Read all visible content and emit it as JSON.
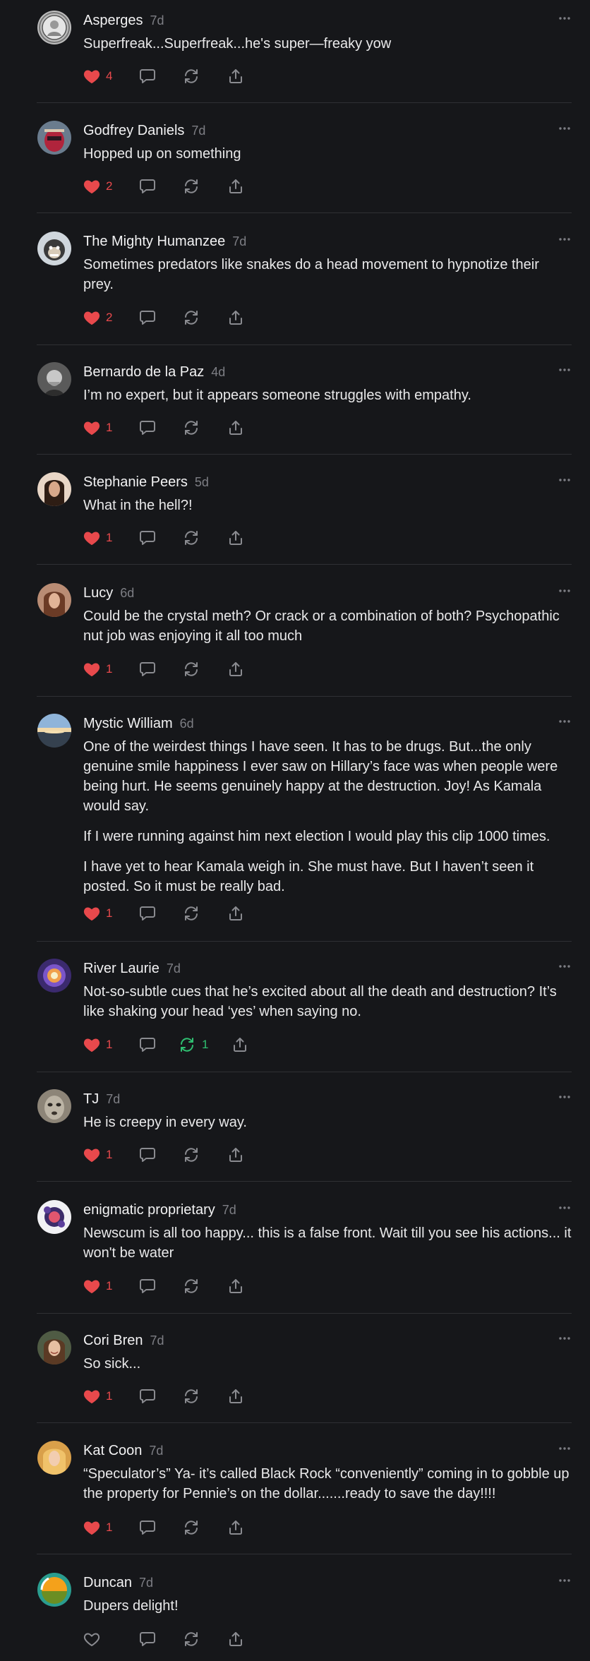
{
  "colors": {
    "background": "#16171a",
    "divider": "#2f3034",
    "like_active": "#e8494c",
    "restack_active": "#2fbf71",
    "icon_default": "#8a8b90"
  },
  "icons": {
    "like": "heart-icon",
    "reply": "comment-icon",
    "restack": "restack-icon",
    "share": "share-icon",
    "more": "more-dots-icon"
  },
  "comments": [
    {
      "name": "Asperges",
      "time": "7d",
      "text": [
        "Superfreak...Superfreak...he's super—freaky yow"
      ],
      "likes": "4",
      "liked": true,
      "restacks": "",
      "restacked": false,
      "avatar": "statue"
    },
    {
      "name": "Godfrey Daniels",
      "time": "7d",
      "text": [
        "Hopped up on something"
      ],
      "likes": "2",
      "liked": true,
      "restacks": "",
      "restacked": false,
      "avatar": "mask"
    },
    {
      "name": "The Mighty Humanzee",
      "time": "7d",
      "text": [
        "Sometimes predators like snakes do a head movement to hypnotize their prey."
      ],
      "likes": "2",
      "liked": true,
      "restacks": "",
      "restacked": false,
      "avatar": "chimp"
    },
    {
      "name": "Bernardo de la Paz",
      "time": "4d",
      "text": [
        "I’m no expert, but it appears someone struggles with empathy."
      ],
      "likes": "1",
      "liked": true,
      "restacks": "",
      "restacked": false,
      "avatar": "bw-man"
    },
    {
      "name": "Stephanie Peers",
      "time": "5d",
      "text": [
        "What in the hell?!"
      ],
      "likes": "1",
      "liked": true,
      "restacks": "",
      "restacked": false,
      "avatar": "woman-dark-hair"
    },
    {
      "name": "Lucy",
      "time": "6d",
      "text": [
        "Could be the crystal meth? Or crack or a combination of both? Psychopathic nut job was enjoying it all too much"
      ],
      "likes": "1",
      "liked": true,
      "restacks": "",
      "restacked": false,
      "avatar": "woman-brown-hair"
    },
    {
      "name": "Mystic William",
      "time": "6d",
      "text": [
        "One of the weirdest things I have seen. It has to be drugs. But...the only genuine smile happiness I ever saw on Hillary’s face was when people were being hurt. He seems genuinely happy at the destruction. Joy! As Kamala would say.",
        "If I were running against him next election I would play this clip 1000 times.",
        "I have yet to hear Kamala weigh in. She must have. But I haven’t seen it posted. So it must be really bad."
      ],
      "likes": "1",
      "liked": true,
      "restacks": "",
      "restacked": false,
      "avatar": "sunset"
    },
    {
      "name": "River Laurie",
      "time": "7d",
      "text": [
        "Not-so-subtle cues that he’s excited about all the death and destruction? It’s like shaking your head ‘yes’ when saying no."
      ],
      "likes": "1",
      "liked": true,
      "restacks": "1",
      "restacked": true,
      "avatar": "mandala"
    },
    {
      "name": "TJ",
      "time": "7d",
      "text": [
        "He is creepy in every way."
      ],
      "likes": "1",
      "liked": true,
      "restacks": "",
      "restacked": false,
      "avatar": "alien"
    },
    {
      "name": "enigmatic proprietary",
      "time": "7d",
      "text": [
        "Newscum is all too happy... this is a false front. Wait till you see his actions... it won't be water"
      ],
      "likes": "1",
      "liked": true,
      "restacks": "",
      "restacked": false,
      "avatar": "pattern"
    },
    {
      "name": "Cori Bren",
      "time": "7d",
      "text": [
        "So sick..."
      ],
      "likes": "1",
      "liked": true,
      "restacks": "",
      "restacked": false,
      "avatar": "woman-smile"
    },
    {
      "name": "Kat Coon",
      "time": "7d",
      "text": [
        "“Speculator’s” Ya- it’s called Black Rock “conveniently” coming in to gobble up the property for Pennie’s on the dollar.......ready to save the day!!!!"
      ],
      "likes": "1",
      "liked": true,
      "restacks": "",
      "restacked": false,
      "avatar": "woman-blonde"
    },
    {
      "name": "Duncan",
      "time": "7d",
      "text": [
        "Dupers delight!"
      ],
      "likes": "",
      "liked": false,
      "restacks": "",
      "restacked": false,
      "avatar": "color-circle"
    }
  ]
}
